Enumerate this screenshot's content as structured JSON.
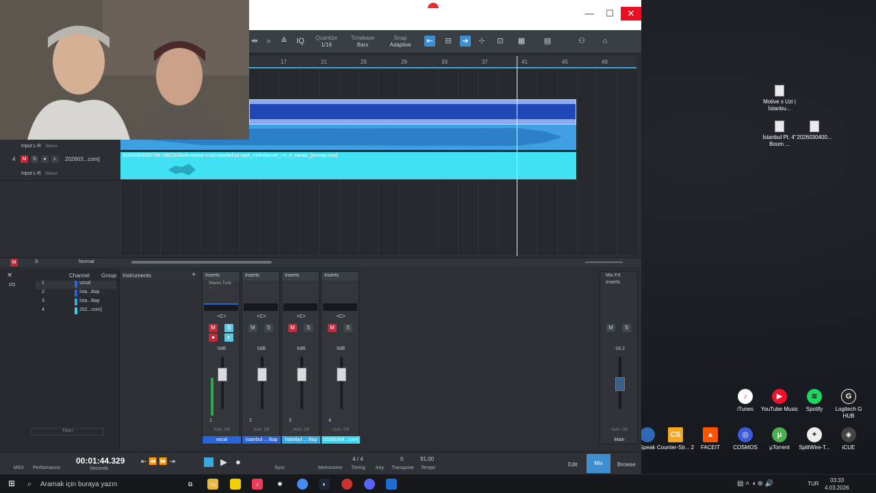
{
  "toolbar": {
    "quantize_label": "Quantize",
    "quantize_value": "1/16",
    "timebase_label": "Timebase",
    "timebase_value": "Bars",
    "snap_label": "Snap",
    "snap_value": "Adaptive"
  },
  "ruler": [
    "17",
    "21",
    "25",
    "29",
    "33",
    "37",
    "41",
    "45",
    "49"
  ],
  "tracks": [
    {
      "input": "Input L-R",
      "stereo": "Stereo"
    },
    {
      "num": "4",
      "m": "M",
      "s": "S",
      "name": "202603...com]",
      "input": "Input L-R",
      "stereo": "Stereo"
    }
  ],
  "clip_label": "20260304000758-73922635e9-motive-x-uzi-istanbul-pt.mp4_melroformer_mt_4_vocals_[mvsep.com]",
  "tl_bottom": {
    "m": "M",
    "s": "S",
    "mode": "Normal"
  },
  "mixer_left": {
    "channel": "Channel",
    "group": "Group",
    "instruments": "Instruments",
    "io": "I/O",
    "filter": "Filter",
    "rows": [
      {
        "n": "1",
        "name": "vocal"
      },
      {
        "n": "2",
        "name": "İsta...Bap"
      },
      {
        "n": "3",
        "name": "İsta...Bap"
      },
      {
        "n": "4",
        "name": "202...com]"
      }
    ]
  },
  "strips": [
    {
      "ins": "Inserts",
      "plugin": "Waves Tune ...",
      "pan": "<C>",
      "db": "0dB",
      "auto": "Auto: Off",
      "num": "1",
      "name": "vocal",
      "color": "#2b63d8"
    },
    {
      "ins": "Inserts",
      "plugin": "",
      "pan": "<C>",
      "db": "0dB",
      "auto": "Auto: Off",
      "num": "2",
      "name": "İstanbul ... Bap",
      "color": "#2b63d8"
    },
    {
      "ins": "Inserts",
      "plugin": "",
      "pan": "<C>",
      "db": "0dB",
      "auto": "Auto: Off",
      "num": "3",
      "name": "İstanbul ... Bap",
      "color": "#3aa8e0"
    },
    {
      "ins": "Inserts",
      "plugin": "",
      "pan": "<C>",
      "db": "0dB",
      "auto": "Auto: Off",
      "num": "4",
      "name": "20260304...com]",
      "color": "#3ad3ee"
    }
  ],
  "main": {
    "fx": "Mix FX",
    "ins": "Inserts",
    "db": "-16.2",
    "auto": "Auto: Off",
    "name": "Main",
    "m": "M",
    "s": "S"
  },
  "transport": {
    "time": "00:01:44.329",
    "seconds": "Seconds",
    "midi": "MIDI",
    "performance": "Performance",
    "sync": "Sync",
    "metronome": "Metronome",
    "sig": "4 / 4",
    "timing": "Timing",
    "key": "Key",
    "transpose": "Transpose",
    "tempo_val": "91.00",
    "tempo": "Tempo",
    "zero": "0",
    "edit": "Edit",
    "mix": "Mix",
    "browse": "Browse"
  },
  "desktop": [
    {
      "label": "Motive x Uzi | İstanbu..."
    },
    {
      "label": "İstanbul Pt. 4\" Boom ..."
    },
    {
      "label": "2026030400..."
    },
    {
      "label": "iTunes"
    },
    {
      "label": "YouTube Music"
    },
    {
      "label": "Spotify"
    },
    {
      "label": "Logitech G HUB"
    },
    {
      "label": "Speak"
    },
    {
      "label": "Counter-Str... 2"
    },
    {
      "label": "FACEIT"
    },
    {
      "label": "COSMOS"
    },
    {
      "label": "μTorrent"
    },
    {
      "label": "SplitWire-T..."
    },
    {
      "label": "iCUE"
    }
  ],
  "taskbar": {
    "search": "Aramak için buraya yazın",
    "lang": "TUR",
    "time": "03:33",
    "date": "4.03.2026"
  }
}
